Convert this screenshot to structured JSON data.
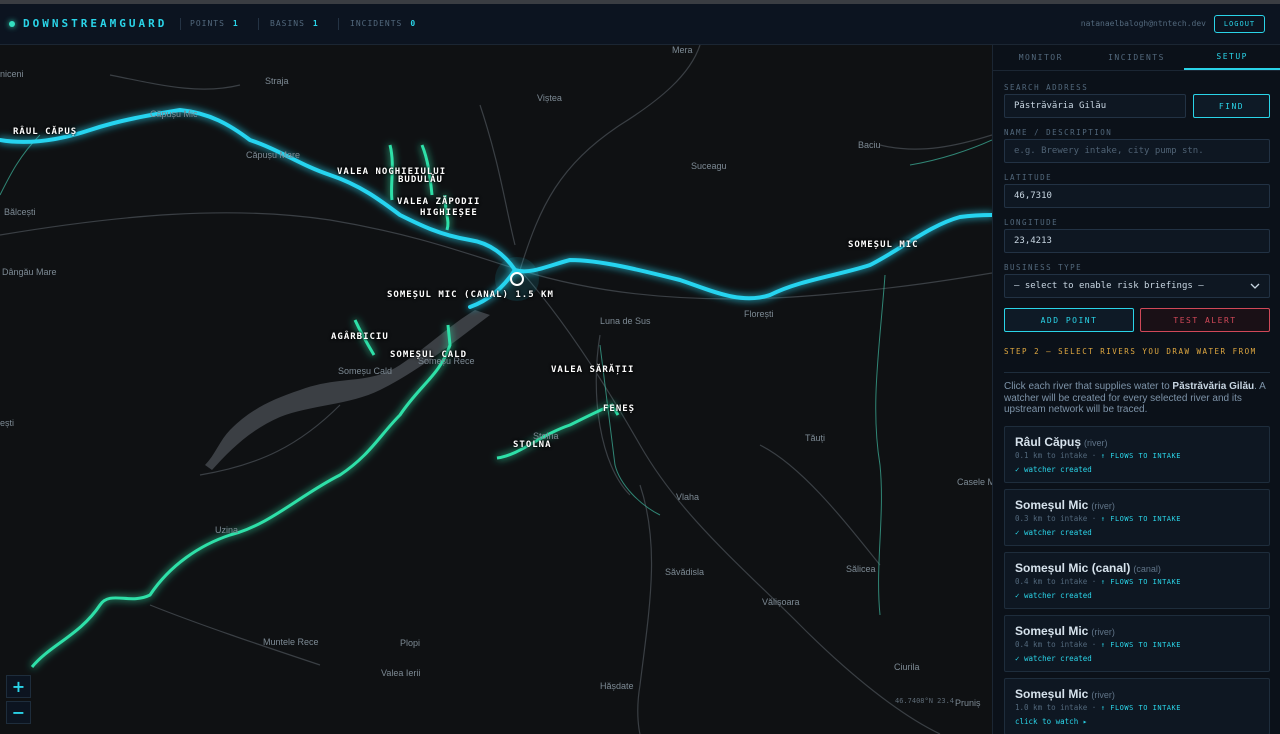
{
  "app": {
    "brand": "DOWNSTREAMGUARD",
    "stats": [
      {
        "label": "POINTS",
        "value": "1"
      },
      {
        "label": "BASINS",
        "value": "1"
      },
      {
        "label": "INCIDENTS",
        "value": "0"
      }
    ],
    "user_email": "natanaelbalogh@ntntech.dev",
    "logout_label": "LOGOUT"
  },
  "map": {
    "places": [
      {
        "name": "niceni"
      },
      {
        "name": "Mera"
      },
      {
        "name": "Straja"
      },
      {
        "name": "Viștea"
      },
      {
        "name": "Căpușu Mic"
      },
      {
        "name": "Căpușu Mare"
      },
      {
        "name": "Baciu"
      },
      {
        "name": "Suceagu"
      },
      {
        "name": "Bălcești"
      },
      {
        "name": "Dângău Mare"
      },
      {
        "name": "Luna de Sus"
      },
      {
        "name": "Florești"
      },
      {
        "name": "Someșu Cald"
      },
      {
        "name": "Someșu Rece"
      },
      {
        "name": "Stolna"
      },
      {
        "name": "Tăuți"
      },
      {
        "name": "Vlaha"
      },
      {
        "name": "Săvădisla"
      },
      {
        "name": "Sălicea"
      },
      {
        "name": "Vălișoara"
      },
      {
        "name": "Uzina"
      },
      {
        "name": "Muntele Rece"
      },
      {
        "name": "Plopi"
      },
      {
        "name": "Valea Ierii"
      },
      {
        "name": "Hășdate"
      },
      {
        "name": "Ciurila"
      },
      {
        "name": "Casele M"
      },
      {
        "name": "Pruniș"
      },
      {
        "name": "ești"
      }
    ],
    "river_labels": [
      "RÂUL CĂPUȘ",
      "VALEA NOGHIEIULUI",
      "BUDULĂU",
      "VALEA ZĂPODII",
      "HIGHIEȘEE",
      "SOMEȘUL MIC",
      "SOMEȘUL MIC (CANAL) 1.5 KM",
      "AGÂRBICIU",
      "SOMEȘUL CALD",
      "VALEA SĂRĂȚII",
      "FENEȘ",
      "STOLNA"
    ],
    "coordinates": "46.7408°N 23.4",
    "zoom_in": "+",
    "zoom_out": "−",
    "colors": {
      "river_selected": "#25d4f0",
      "river_tributary": "#2ee0a8"
    }
  },
  "panel": {
    "tabs": [
      {
        "label": "MONITOR",
        "active": false
      },
      {
        "label": "INCIDENTS",
        "active": false
      },
      {
        "label": "SETUP",
        "active": true
      }
    ],
    "search": {
      "label": "SEARCH ADDRESS",
      "value": "Păstrăvăria Gilău",
      "button": "FIND"
    },
    "name": {
      "label": "NAME / DESCRIPTION",
      "placeholder": "e.g. Brewery intake, city pump stn."
    },
    "latitude": {
      "label": "LATITUDE",
      "value": "46,7310"
    },
    "longitude": {
      "label": "LONGITUDE",
      "value": "23,4213"
    },
    "business": {
      "label": "BUSINESS TYPE",
      "value": "— select to enable risk briefings —"
    },
    "add_point": "ADD POINT",
    "test_alert": "TEST ALERT",
    "step": {
      "title": "STEP 2 — SELECT RIVERS YOU DRAW WATER FROM",
      "desc_before": "Click each river that supplies water to ",
      "desc_bold": "Păstrăvăria Gilău",
      "desc_after": ". A watcher will be created for every selected river and its upstream network will be traced."
    },
    "rivers": [
      {
        "name": "Râul Căpuș",
        "kind": "(river)",
        "distance": "0.1 km to intake",
        "flow": "↑ FLOWS TO INTAKE",
        "status": "✓ watcher created"
      },
      {
        "name": "Someșul Mic",
        "kind": "(river)",
        "distance": "0.3 km to intake",
        "flow": "↑ FLOWS TO INTAKE",
        "status": "✓ watcher created"
      },
      {
        "name": "Someșul Mic (canal)",
        "kind": "(canal)",
        "distance": "0.4 km to intake",
        "flow": "↑ FLOWS TO INTAKE",
        "status": "✓ watcher created"
      },
      {
        "name": "Someșul Mic",
        "kind": "(river)",
        "distance": "0.4 km to intake",
        "flow": "↑ FLOWS TO INTAKE",
        "status": "✓ watcher created"
      },
      {
        "name": "Someșul Mic",
        "kind": "(river)",
        "distance": "1.0 km to intake",
        "flow": "↑ FLOWS TO INTAKE",
        "status": "click to watch ▸"
      }
    ]
  }
}
